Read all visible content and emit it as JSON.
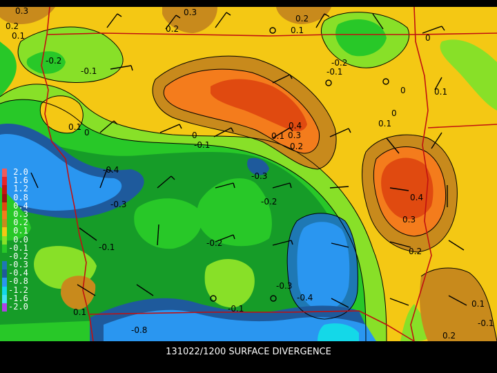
{
  "caption": "131022/1200 SURFACE DIVERGENCE",
  "legend": {
    "entries": [
      {
        "label": " 2.0",
        "color": "#f05a5a"
      },
      {
        "label": " 1.6",
        "color": "#e8242a"
      },
      {
        "label": " 1.2",
        "color": "#c81410"
      },
      {
        "label": " 0.8",
        "color": "#a01010"
      },
      {
        "label": " 0.4",
        "color": "#e04a10"
      },
      {
        "label": " 0.3",
        "color": "#f47c1c"
      },
      {
        "label": " 0.2",
        "color": "#c88a1c"
      },
      {
        "label": " 0.1",
        "color": "#f4c814"
      },
      {
        "label": " 0.0",
        "color": "#88e028"
      },
      {
        "label": "-0.1",
        "color": "#28c828"
      },
      {
        "label": "-0.2",
        "color": "#169c28"
      },
      {
        "label": "-0.3",
        "color": "#1e78b4"
      },
      {
        "label": "-0.4",
        "color": "#1e5a9c"
      },
      {
        "label": "-0.8",
        "color": "#2a96f0"
      },
      {
        "label": "-1.2",
        "color": "#14d8e8"
      },
      {
        "label": "-1.6",
        "color": "#44e0f4"
      },
      {
        "label": "-2.0",
        "color": "#b040e8"
      }
    ]
  },
  "contour_labels": [
    {
      "text": "0.3"
    },
    {
      "text": "0.2"
    },
    {
      "text": "0.1"
    },
    {
      "text": "0.3"
    },
    {
      "text": "0.2"
    },
    {
      "text": "0.2"
    },
    {
      "text": "0.1"
    },
    {
      "text": "0.1"
    },
    {
      "text": "0"
    },
    {
      "text": "-0.2"
    },
    {
      "text": "-0.1"
    },
    {
      "text": "-0.2"
    },
    {
      "text": "-0.1"
    },
    {
      "text": "0"
    },
    {
      "text": "0.1"
    },
    {
      "text": "0"
    },
    {
      "text": "0.1"
    },
    {
      "text": "0.1"
    },
    {
      "text": "0"
    },
    {
      "text": "0"
    },
    {
      "text": "-0.1"
    },
    {
      "text": "0.4"
    },
    {
      "text": "0.1"
    },
    {
      "text": "0.3"
    },
    {
      "text": "0.2"
    },
    {
      "text": "-0.3"
    },
    {
      "text": "-0.4"
    },
    {
      "text": "-0.3"
    },
    {
      "text": "-0.2"
    },
    {
      "text": "0.4"
    },
    {
      "text": "0.3"
    },
    {
      "text": "0.2"
    },
    {
      "text": "-0.1"
    },
    {
      "text": "-0.2"
    },
    {
      "text": "-0.3"
    },
    {
      "text": "-0.4"
    },
    {
      "text": "-0.1"
    },
    {
      "text": "0.1"
    },
    {
      "text": "-0.8"
    },
    {
      "text": "0.1"
    },
    {
      "text": "-0.1"
    },
    {
      "text": "0.2"
    }
  ]
}
